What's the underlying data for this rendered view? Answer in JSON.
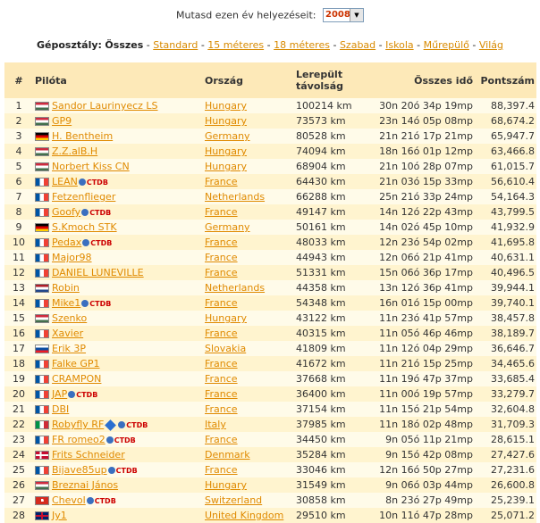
{
  "year_selector": {
    "label": "Mutasd ezen év helyezéseit:",
    "value": "2008"
  },
  "class_filter": {
    "label": "Géposztály:",
    "current": "Összes",
    "links": [
      "Standard",
      "15 méteres",
      "18 méteres",
      "Szabad",
      "Iskola",
      "Műrepülő",
      "Világ"
    ]
  },
  "table": {
    "headers": {
      "rank": "#",
      "pilot": "Pilóta",
      "country": "Ország",
      "distance": "Lerepült távolság",
      "time": "Összes idő",
      "points": "Pontszám"
    },
    "rows": [
      {
        "rank": "1",
        "pilot": "Sandor Laurinyecz LS",
        "flag": "hu",
        "ctdb": false,
        "blue": false,
        "country": "Hungary",
        "distance": "100214 km",
        "time": "30n 20ó 34p 19mp",
        "points": "88,397.4"
      },
      {
        "rank": "2",
        "pilot": "GP9",
        "flag": "hu",
        "ctdb": false,
        "blue": false,
        "country": "Hungary",
        "distance": "73573 km",
        "time": "23n 14ó 05p 08mp",
        "points": "68,674.2"
      },
      {
        "rank": "3",
        "pilot": "H. Bentheim",
        "flag": "de",
        "ctdb": false,
        "blue": false,
        "country": "Germany",
        "distance": "80528 km",
        "time": "21n 21ó 17p 21mp",
        "points": "65,947.7"
      },
      {
        "rank": "4",
        "pilot": "Z.Z.alB.H",
        "flag": "hu",
        "ctdb": false,
        "blue": false,
        "country": "Hungary",
        "distance": "74094 km",
        "time": "18n 16ó 01p 12mp",
        "points": "63,466.8"
      },
      {
        "rank": "5",
        "pilot": "Norbert Kiss CN",
        "flag": "hu",
        "ctdb": false,
        "blue": false,
        "country": "Hungary",
        "distance": "68904 km",
        "time": "21n 10ó 28p 07mp",
        "points": "61,015.7"
      },
      {
        "rank": "6",
        "pilot": "LEAN",
        "flag": "fr",
        "ctdb": true,
        "blue": false,
        "country": "France",
        "distance": "64430 km",
        "time": "21n 03ó 15p 33mp",
        "points": "56,610.4"
      },
      {
        "rank": "7",
        "pilot": "Fetzenflieger",
        "flag": "fr",
        "ctdb": false,
        "blue": false,
        "country": "Netherlands",
        "distance": "66288 km",
        "time": "25n 21ó 33p 24mp",
        "points": "54,164.3"
      },
      {
        "rank": "8",
        "pilot": "Goofy",
        "flag": "fr",
        "ctdb": true,
        "blue": false,
        "country": "France",
        "distance": "49147 km",
        "time": "14n 12ó 22p 43mp",
        "points": "43,799.5"
      },
      {
        "rank": "9",
        "pilot": "S.Kmoch STK",
        "flag": "de",
        "ctdb": false,
        "blue": false,
        "country": "Germany",
        "distance": "50161 km",
        "time": "14n 02ó 45p 10mp",
        "points": "41,932.9"
      },
      {
        "rank": "10",
        "pilot": "Pedax",
        "flag": "fr",
        "ctdb": true,
        "blue": false,
        "country": "France",
        "distance": "48033 km",
        "time": "12n 23ó 54p 02mp",
        "points": "41,695.8"
      },
      {
        "rank": "11",
        "pilot": "Major98",
        "flag": "fr",
        "ctdb": false,
        "blue": false,
        "country": "France",
        "distance": "44943 km",
        "time": "12n 06ó 21p 41mp",
        "points": "40,631.1"
      },
      {
        "rank": "12",
        "pilot": "DANIEL LUNEVILLE",
        "flag": "fr",
        "ctdb": false,
        "blue": false,
        "country": "France",
        "distance": "51331 km",
        "time": "15n 06ó 36p 17mp",
        "points": "40,496.5"
      },
      {
        "rank": "13",
        "pilot": "Robin",
        "flag": "nl",
        "ctdb": false,
        "blue": false,
        "country": "Netherlands",
        "distance": "44358 km",
        "time": "13n 12ó 36p 41mp",
        "points": "39,944.1"
      },
      {
        "rank": "14",
        "pilot": "Mike1",
        "flag": "fr",
        "ctdb": true,
        "blue": false,
        "country": "France",
        "distance": "54348 km",
        "time": "16n 01ó 15p 00mp",
        "points": "39,740.1"
      },
      {
        "rank": "15",
        "pilot": "Szenko",
        "flag": "hu",
        "ctdb": false,
        "blue": false,
        "country": "Hungary",
        "distance": "43122 km",
        "time": "11n 23ó 41p 57mp",
        "points": "38,457.8"
      },
      {
        "rank": "16",
        "pilot": "Xavier",
        "flag": "fr",
        "ctdb": false,
        "blue": false,
        "country": "France",
        "distance": "40315 km",
        "time": "11n 05ó 46p 46mp",
        "points": "38,189.7"
      },
      {
        "rank": "17",
        "pilot": "Erik 3P",
        "flag": "sk",
        "ctdb": false,
        "blue": false,
        "country": "Slovakia",
        "distance": "41809 km",
        "time": "11n 12ó 04p 29mp",
        "points": "36,646.7"
      },
      {
        "rank": "18",
        "pilot": "Falke GP1",
        "flag": "fr",
        "ctdb": false,
        "blue": false,
        "country": "France",
        "distance": "41672 km",
        "time": "11n 21ó 15p 25mp",
        "points": "34,465.6"
      },
      {
        "rank": "19",
        "pilot": "CRAMPON",
        "flag": "fr",
        "ctdb": false,
        "blue": false,
        "country": "France",
        "distance": "37668 km",
        "time": "11n 19ó 47p 37mp",
        "points": "33,685.4"
      },
      {
        "rank": "20",
        "pilot": "JAP",
        "flag": "fr",
        "ctdb": true,
        "blue": false,
        "country": "France",
        "distance": "36400 km",
        "time": "11n 00ó 19p 57mp",
        "points": "33,279.7"
      },
      {
        "rank": "21",
        "pilot": "DBI",
        "flag": "fr",
        "ctdb": false,
        "blue": false,
        "country": "France",
        "distance": "37154 km",
        "time": "11n 15ó 21p 54mp",
        "points": "32,604.8"
      },
      {
        "rank": "22",
        "pilot": "Robyfly RF",
        "flag": "it",
        "ctdb": true,
        "blue": true,
        "country": "Italy",
        "distance": "37985 km",
        "time": "11n 18ó 02p 48mp",
        "points": "31,709.3"
      },
      {
        "rank": "23",
        "pilot": "FR romeo2",
        "flag": "fr",
        "ctdb": true,
        "blue": false,
        "country": "France",
        "distance": "34450 km",
        "time": "9n 05ó 11p 21mp",
        "points": "28,615.1"
      },
      {
        "rank": "24",
        "pilot": "Frits Schneider",
        "flag": "dk",
        "ctdb": false,
        "blue": false,
        "country": "Denmark",
        "distance": "35284 km",
        "time": "9n 15ó 42p 08mp",
        "points": "27,427.6"
      },
      {
        "rank": "25",
        "pilot": "Bijave85up",
        "flag": "fr",
        "ctdb": true,
        "blue": false,
        "country": "France",
        "distance": "33046 km",
        "time": "12n 16ó 50p 27mp",
        "points": "27,231.6"
      },
      {
        "rank": "26",
        "pilot": "Breznai János",
        "flag": "hu",
        "ctdb": false,
        "blue": false,
        "country": "Hungary",
        "distance": "31549 km",
        "time": "9n 06ó 03p 44mp",
        "points": "26,600.8"
      },
      {
        "rank": "27",
        "pilot": "Chevol",
        "flag": "ch",
        "ctdb": true,
        "blue": false,
        "country": "Switzerland",
        "distance": "30858 km",
        "time": "8n 23ó 27p 49mp",
        "points": "25,239.1"
      },
      {
        "rank": "28",
        "pilot": "Jy1",
        "flag": "gb",
        "ctdb": false,
        "blue": false,
        "country": "United Kingdom",
        "distance": "29510 km",
        "time": "10n 11ó 47p 28mp",
        "points": "25,071.2"
      }
    ]
  },
  "ctdb_label": "CTDB"
}
